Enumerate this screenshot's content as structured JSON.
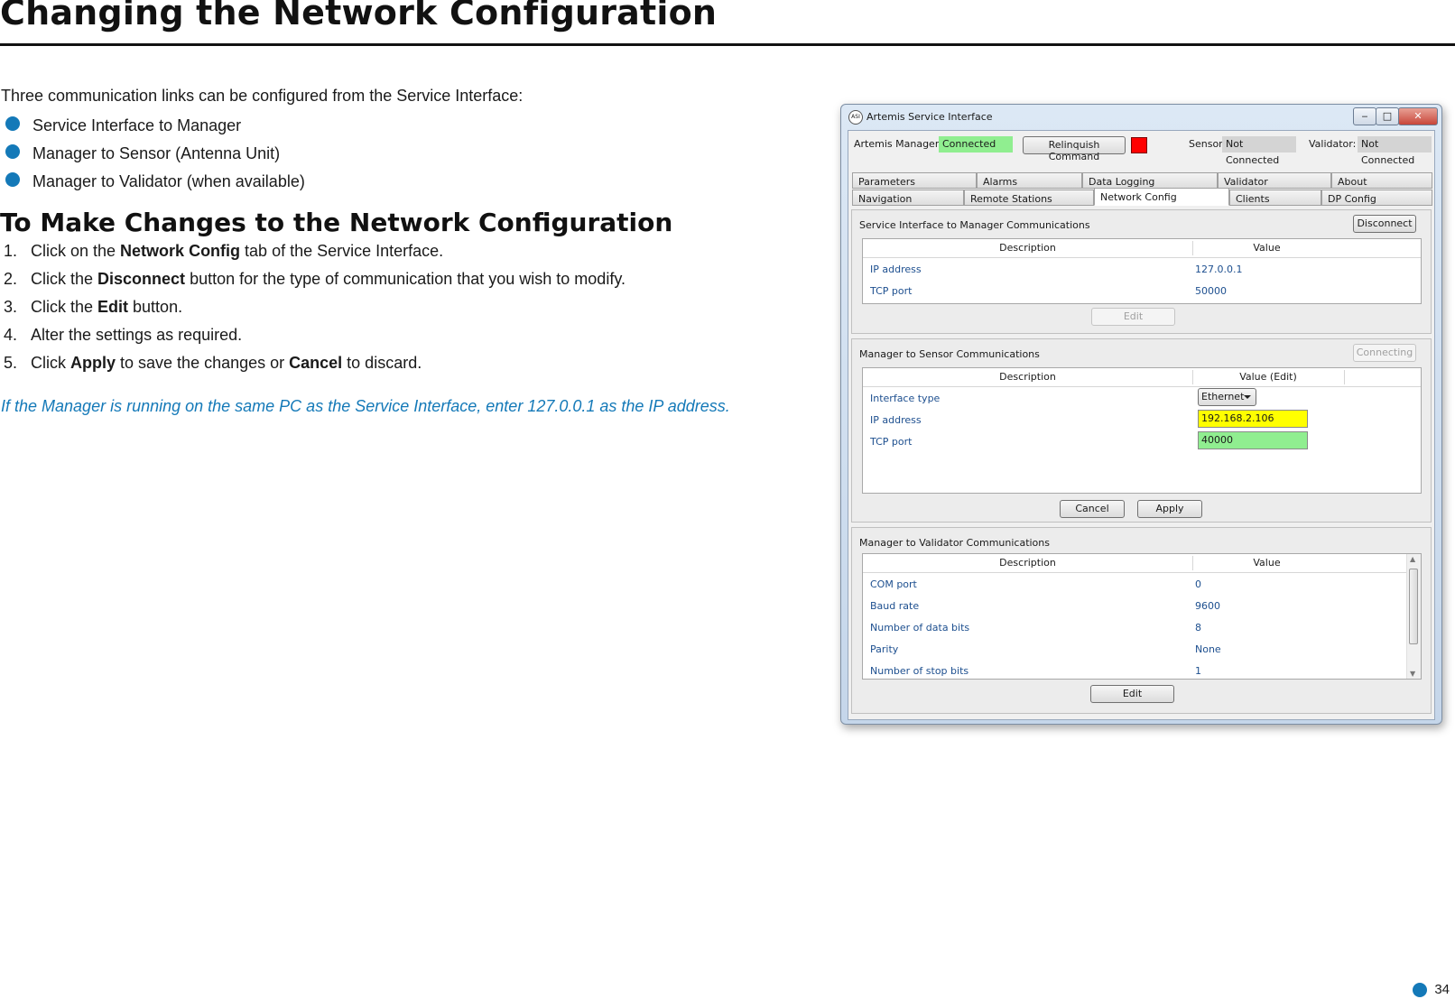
{
  "page": {
    "title": "Changing the Network Configuration",
    "intro": "Three communication links can be configured from the Service Interface:",
    "bullets": [
      "Service Interface to Manager",
      "Manager to Sensor (Antenna Unit)",
      "Manager to Validator (when available)"
    ],
    "section_heading": "To Make Changes to the Network Configuration",
    "steps": [
      {
        "num": "1.",
        "pre": "Click on the ",
        "bold": "Network Config",
        "post": " tab of the Service Interface."
      },
      {
        "num": "2.",
        "pre": "Click the ",
        "bold": "Disconnect",
        "post": " button for the type of communication that you wish to modify."
      },
      {
        "num": "3.",
        "pre": "Click the ",
        "bold": "Edit",
        "post": " button."
      },
      {
        "num": "4.",
        "pre": "Alter the settings as required.",
        "bold": "",
        "post": ""
      },
      {
        "num": "5.",
        "pre": "Click ",
        "bold": "Apply",
        "post": " to save the changes or ",
        "bold2": "Cancel",
        "post2": " to discard."
      }
    ],
    "note": "If the Manager is running on the same PC as the Service Interface, enter 127.0.0.1 as the IP address.",
    "page_number": "34",
    "accent_color": "#1479b8"
  },
  "window": {
    "icon_text": "ASI",
    "title": "Artemis Service Interface",
    "controls": {
      "minimize": "‒",
      "maximize": "□",
      "close": "✕"
    },
    "top_bar": {
      "manager_label": "Artemis Manager:",
      "manager_status": "Connected",
      "relinquish_label": "Relinquish Command",
      "sensor_label": "Sensor:",
      "sensor_status": "Not Connected",
      "validator_label": "Validator:",
      "validator_status": "Not Connected"
    },
    "tabs_row1": [
      "Parameters",
      "Alarms",
      "Data Logging",
      "Validator",
      "About"
    ],
    "tabs_row2": [
      "Navigation",
      "Remote Stations",
      "Network Config",
      "Clients",
      "DP Config"
    ],
    "active_tab": "Network Config",
    "si_manager": {
      "title": "Service Interface to Manager Communications",
      "disconnect_label": "Disconnect",
      "col_description": "Description",
      "col_value": "Value",
      "rows": [
        {
          "description": "IP address",
          "value": "127.0.0.1"
        },
        {
          "description": "TCP port",
          "value": "50000"
        }
      ],
      "edit_label": "Edit"
    },
    "manager_sensor": {
      "title": "Manager to Sensor Communications",
      "connecting_label": "Connecting",
      "col_description": "Description",
      "col_value": "Value (Edit)",
      "interface_type_label": "Interface type",
      "interface_type_value": "Ethernet",
      "ip_label": "IP address",
      "ip_value": "192.168.2.106",
      "port_label": "TCP port",
      "port_value": "40000",
      "cancel_label": "Cancel",
      "apply_label": "Apply"
    },
    "manager_validator": {
      "title": "Manager to Validator Communications",
      "col_description": "Description",
      "col_value": "Value",
      "rows": [
        {
          "description": "COM port",
          "value": "0"
        },
        {
          "description": "Baud rate",
          "value": "9600"
        },
        {
          "description": "Number of data bits",
          "value": "8"
        },
        {
          "description": "Parity",
          "value": "None"
        },
        {
          "description": "Number of stop bits",
          "value": "1"
        }
      ],
      "edit_label": "Edit"
    }
  }
}
